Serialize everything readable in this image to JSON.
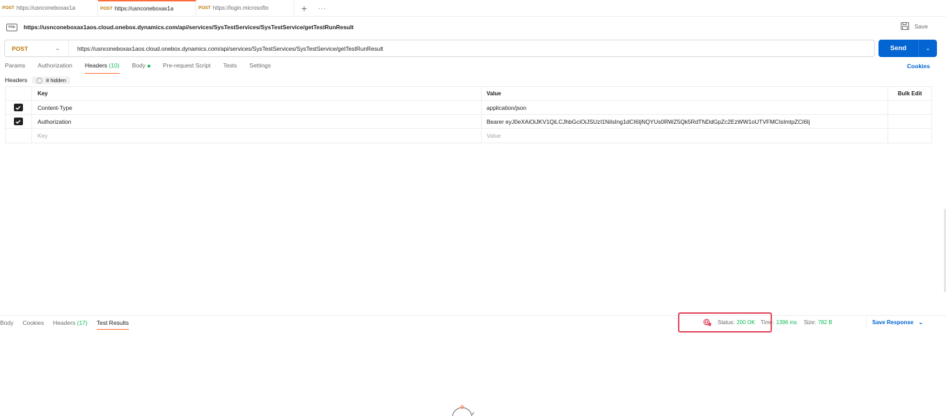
{
  "tabs": [
    {
      "method": "POST",
      "url": "https://usnconeboxax1a",
      "active": false
    },
    {
      "method": "POST",
      "url": "https://usnconeboxax1a",
      "active": true
    },
    {
      "method": "POST",
      "url": "https://login.microsofto",
      "active": false
    }
  ],
  "tabbar": {
    "add_label": "+",
    "more_label": "···"
  },
  "request": {
    "icon_text": "http",
    "title_url": "https://usnconeboxax1aos.cloud.onebox.dynamics.com/api/services/SysTestServices/SysTestService/getTestRunResult",
    "save_label": "Save",
    "method": "POST",
    "url": "https://usnconeboxax1aos.cloud.onebox.dynamics.com/api/services/SysTestServices/SysTestService/getTestRunResult",
    "send_label": "Send"
  },
  "req_tabs": {
    "params": "Params",
    "authorization": "Authorization",
    "headers": "Headers",
    "headers_count": "(10)",
    "body": "Body",
    "prerequest": "Pre-request Script",
    "tests": "Tests",
    "settings": "Settings",
    "cookies": "Cookies"
  },
  "headers_section": {
    "label": "Headers",
    "hidden": "8 hidden",
    "col_key": "Key",
    "col_value": "Value",
    "bulk_edit": "Bulk Edit",
    "rows": [
      {
        "checked": true,
        "key": "Content-Type",
        "value": "application/json"
      },
      {
        "checked": true,
        "key": "Authorization",
        "value": "Bearer eyJ0eXAiOiJKV1QiLCJhbGciOiJSUzI1NiIsIng1dCI6IjNQYUs0RWZ5Qk5RdTNDdGpZc2EzWW1oUTVFMCIsImtpZCI6Ij"
      }
    ],
    "placeholder_key": "Key",
    "placeholder_value": "Value"
  },
  "response": {
    "tabs": {
      "body": "Body",
      "cookies": "Cookies",
      "headers": "Headers",
      "headers_count": "(17)",
      "test_results": "Test Results"
    },
    "status_label": "Status:",
    "status_value": "200 OK",
    "time_label": "Time:",
    "time_value": "1396 ms",
    "size_label": "Size:",
    "size_value": "782 B",
    "save_response": "Save Response"
  },
  "colors": {
    "accent": "#ff6c37",
    "send": "#0265d2",
    "method": "#b9790a",
    "ok": "#0cbb52",
    "highlight": "#e0445a"
  }
}
